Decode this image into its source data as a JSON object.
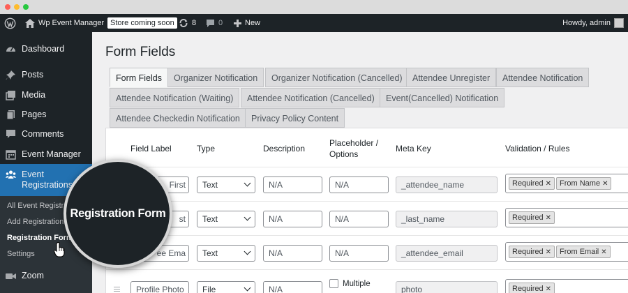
{
  "adminbar": {
    "site_name": "Wp Event Manager",
    "store_badge": "Store coming soon",
    "updates_count": "8",
    "comments_count": "0",
    "new_label": "New",
    "howdy": "Howdy, admin"
  },
  "sidebar": {
    "items": [
      {
        "label": "Dashboard",
        "icon": "dashboard-icon"
      },
      {
        "label": "Posts",
        "icon": "pin-icon"
      },
      {
        "label": "Media",
        "icon": "media-icon"
      },
      {
        "label": "Pages",
        "icon": "pages-icon"
      },
      {
        "label": "Comments",
        "icon": "comment-icon"
      },
      {
        "label": "Event Manager",
        "icon": "calendar-icon"
      },
      {
        "label": "Event Registrations",
        "icon": "groups-icon"
      },
      {
        "label": "Zoom",
        "icon": "video-icon"
      }
    ],
    "submenu": [
      {
        "label": "All Event Registrations"
      },
      {
        "label": "Add Registration"
      },
      {
        "label": "Registration Form"
      },
      {
        "label": "Settings"
      }
    ]
  },
  "magnifier": {
    "label": "Registration Form"
  },
  "page": {
    "title": "Form Fields"
  },
  "tabs": [
    "Form Fields",
    "Organizer Notification",
    "Organizer Notification (Cancelled)",
    "Attendee Unregister",
    "Attendee Notification",
    "Attendee Notification (Waiting)",
    "Attendee Notification (Cancelled)",
    "Event(Cancelled) Notification",
    "Attendee Checkedin Notification",
    "Privacy Policy Content"
  ],
  "table": {
    "headers": {
      "label": "Field Label",
      "type": "Type",
      "description": "Description",
      "placeholder": "Placeholder / Options",
      "metakey": "Meta Key",
      "validation": "Validation / Rules"
    },
    "rows": [
      {
        "label": "First",
        "type": "Text",
        "description": "N/A",
        "placeholder": "N/A",
        "metakey": "_attendee_name",
        "rules": [
          "Required",
          "From Name"
        ]
      },
      {
        "label": "st",
        "type": "Text",
        "description": "N/A",
        "placeholder": "N/A",
        "metakey": "_last_name",
        "rules": [
          "Required"
        ]
      },
      {
        "label": "ee Ema",
        "type": "Text",
        "description": "N/A",
        "placeholder": "N/A",
        "metakey": "_attendee_email",
        "rules": [
          "Required",
          "From Email"
        ]
      },
      {
        "label": "Profile Photo",
        "type": "File",
        "description": "N/A",
        "placeholder": "Multiple",
        "metakey": "photo",
        "rules": [
          "Required"
        ]
      }
    ]
  },
  "colors": {
    "adminbar": "#1d2327",
    "active_menu": "#2271b1",
    "page_bg": "#f0f0f1"
  }
}
